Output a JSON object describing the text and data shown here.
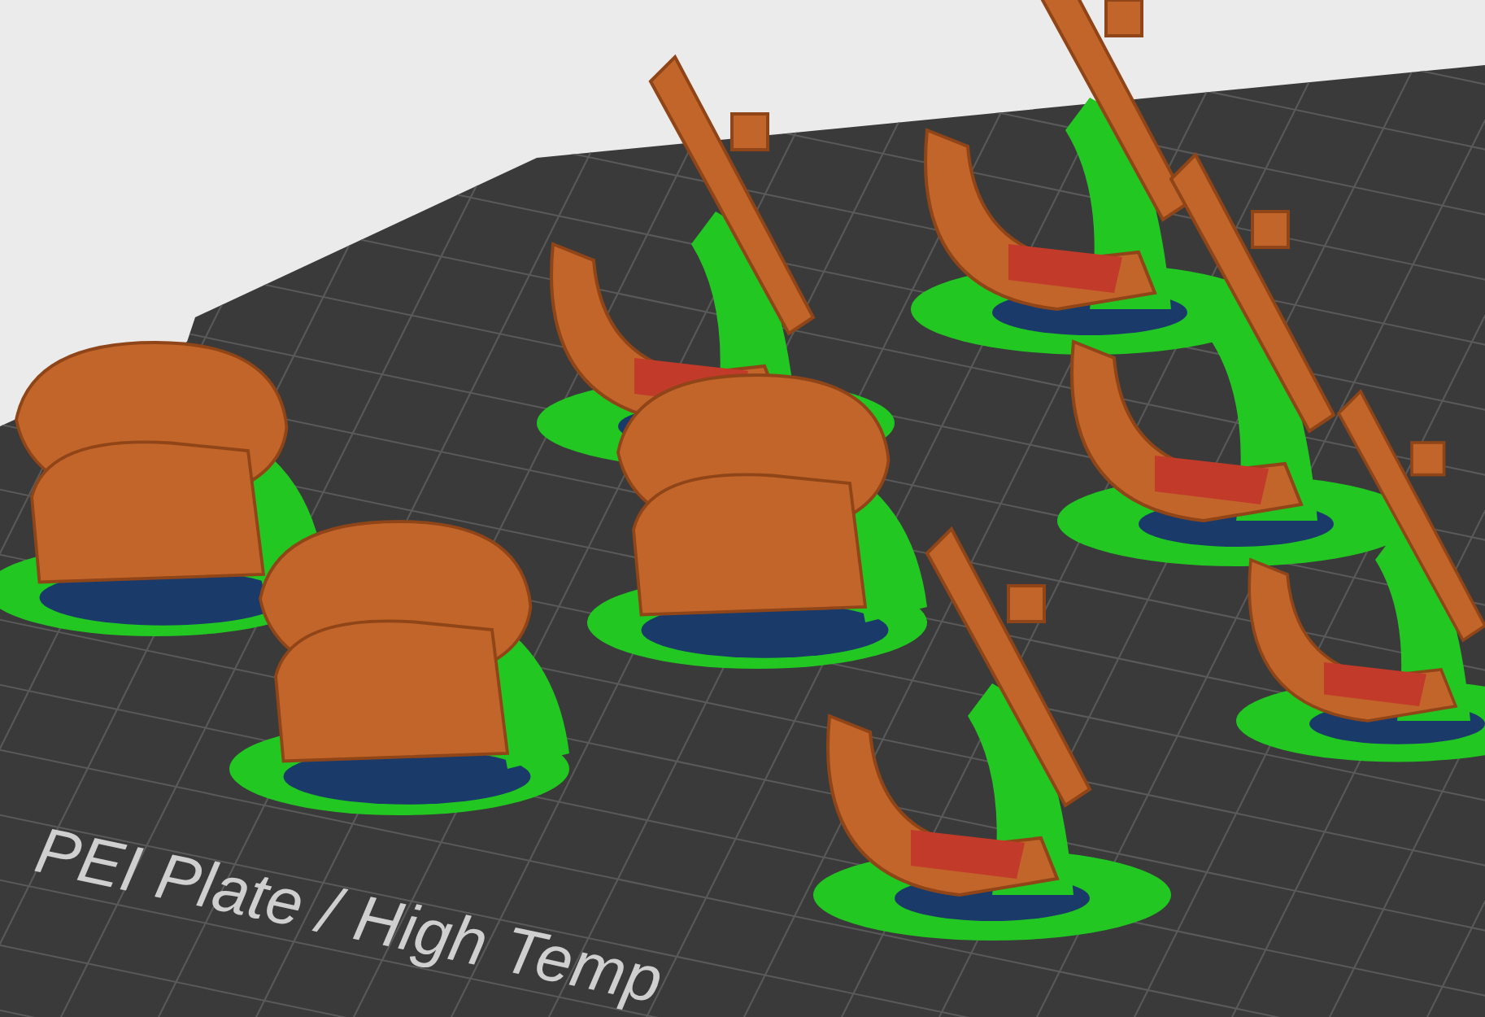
{
  "viewport": {
    "plate_label": "PEI Plate / High Temp"
  }
}
